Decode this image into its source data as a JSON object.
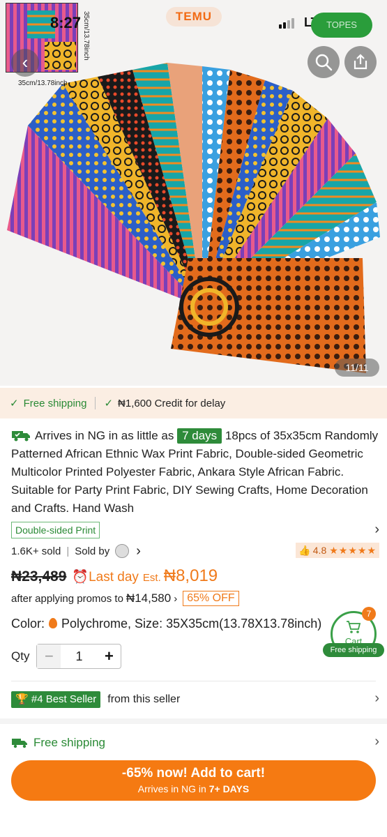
{
  "status_bar": {
    "time": "8:27",
    "network": "LTE",
    "pill_text": "TOPES"
  },
  "hero": {
    "brand": "TEMU",
    "dimension_vertical": "35cm/13.78inch",
    "dimension_horizontal": "35cm/13.78inch",
    "image_counter": "11/11"
  },
  "shipping_strip": {
    "free_shipping": "Free shipping",
    "credit": "₦1,600 Credit for delay"
  },
  "product": {
    "arrives_text": "Arrives in NG in as little as",
    "arrives_days": "7 days",
    "title": "18pcs of 35x35cm Randomly Patterned African Ethnic Wax Print Fabric, Double-sided Geometric Multicolor Printed Polyester Fabric, Ankara Style African Fabric. Suitable for Party Print Fabric, DIY Sewing Crafts, Home Decoration and Crafts. Hand Wash",
    "tag": "Double-sided Print",
    "sold": "1.6K+ sold",
    "sold_by": "Sold by",
    "rating": "4.8",
    "stars": "★★★★★"
  },
  "price": {
    "original": "₦23,489",
    "last_day": "Last day",
    "est_label": "Est.",
    "est_price": "₦8,019",
    "promo_text": "after applying promos to",
    "promo_price": "₦14,580",
    "discount": "65% OFF"
  },
  "options": {
    "color_label": "Color:",
    "color_value": "Polychrome, Size: 35X35cm(13.78X13.78inch)"
  },
  "cart_float": {
    "count": "7",
    "label": "Cart",
    "ship": "Free shipping"
  },
  "quantity": {
    "label": "Qty",
    "value": "1"
  },
  "best_seller": {
    "tag": "#4 Best Seller",
    "text": "from this seller"
  },
  "free_shipping_row": {
    "label": "Free shipping"
  },
  "add_to_cart": {
    "line1": "-65% now! Add to cart!",
    "line2_prefix": "Arrives in NG in",
    "line2_bold": "7+ DAYS"
  },
  "colors": {
    "accent_orange": "#f57a12",
    "green": "#2e8b3a",
    "strip_bg": "#fbeee3"
  }
}
